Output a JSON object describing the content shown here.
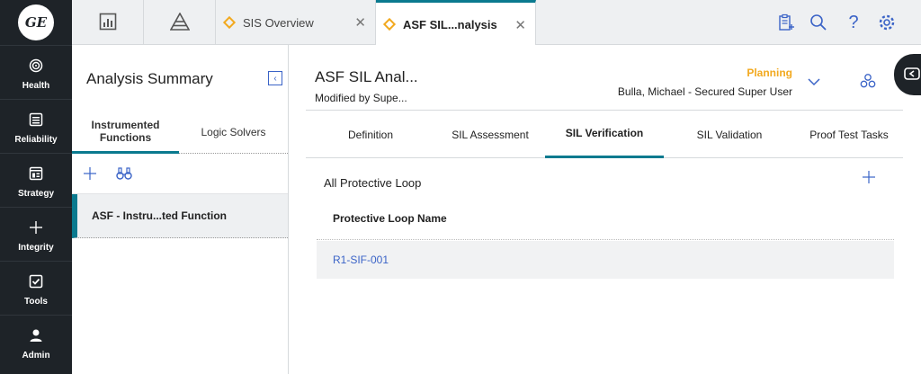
{
  "app": {
    "logo_text": "GE"
  },
  "nav": [
    {
      "label": "Health",
      "icon": "target-icon"
    },
    {
      "label": "Reliability",
      "icon": "list-icon"
    },
    {
      "label": "Strategy",
      "icon": "document-icon"
    },
    {
      "label": "Integrity",
      "icon": "plus-icon"
    },
    {
      "label": "Tools",
      "icon": "checkbox-icon"
    },
    {
      "label": "Admin",
      "icon": "user-icon"
    }
  ],
  "tabs": [
    {
      "label": "SIS Overview"
    },
    {
      "label": "ASF SIL...nalysis"
    }
  ],
  "summary": {
    "title": "Analysis Summary",
    "tabs": [
      "Instrumented Functions",
      "Logic Solvers"
    ],
    "items": [
      "ASF - Instru...ted Function"
    ]
  },
  "record": {
    "title": "ASF SIL Anal...",
    "subtitle": "Modified by Supe...",
    "state": "Planning",
    "user": "Bulla, Michael - Secured Super User"
  },
  "main_tabs": [
    "Definition",
    "SIL Assessment",
    "SIL Verification",
    "SIL Validation",
    "Proof Test Tasks"
  ],
  "section": {
    "title": "All Protective Loop",
    "column": "Protective Loop Name",
    "rows": [
      "R1-SIF-001"
    ]
  },
  "colors": {
    "accent": "#0a7a8f",
    "link": "#3a63c7",
    "state": "#f2a91f",
    "nav_bg": "#1e2328"
  }
}
